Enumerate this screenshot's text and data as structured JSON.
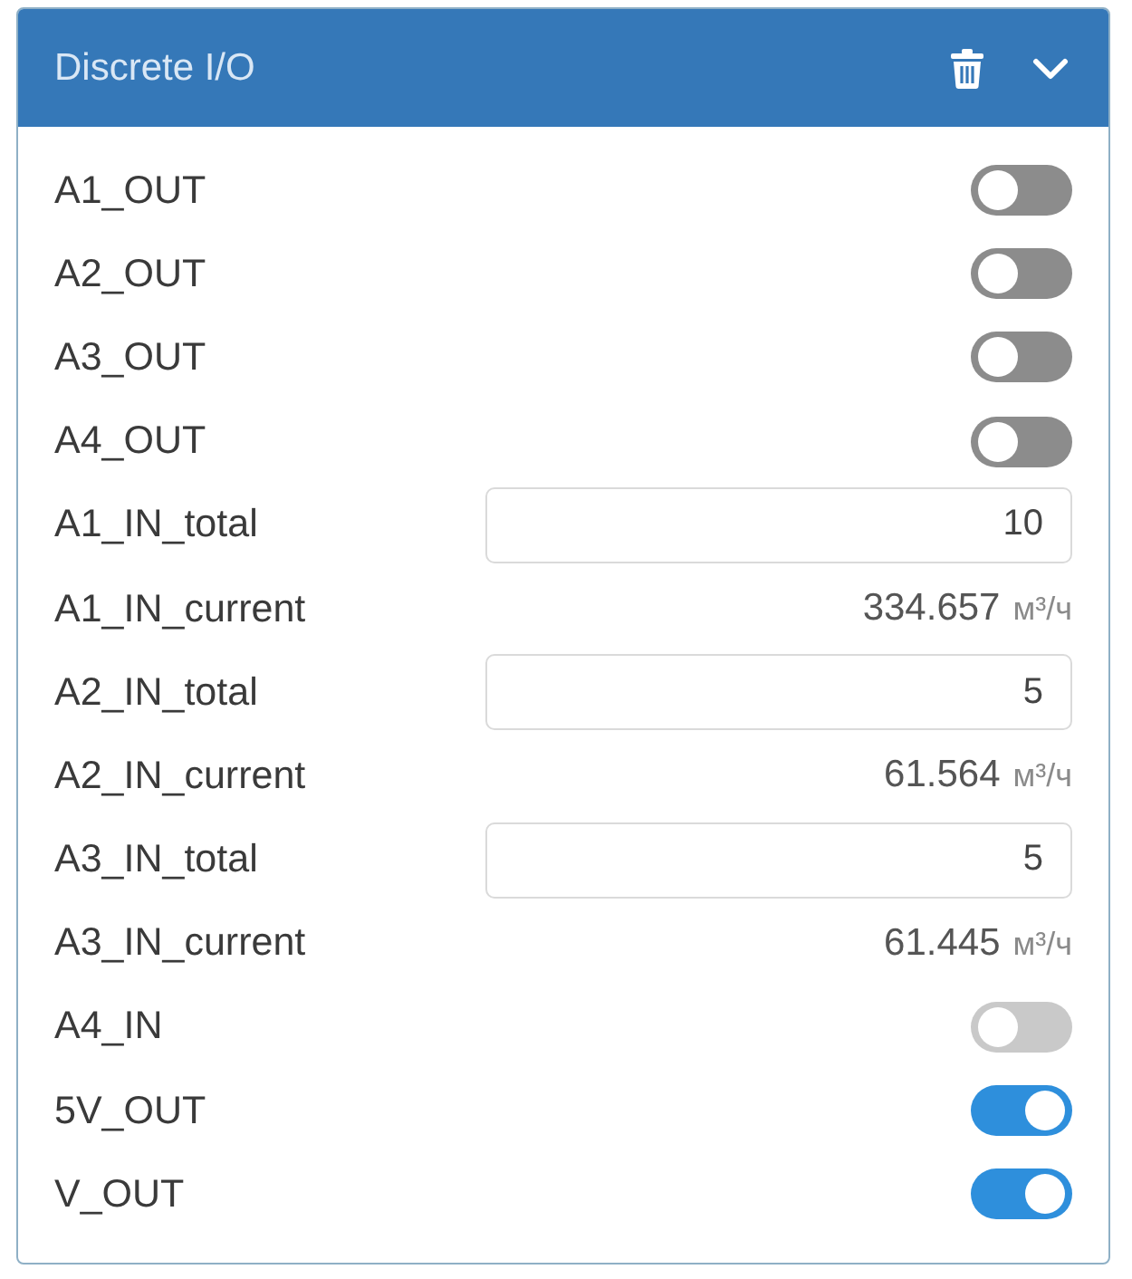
{
  "panel": {
    "title": "Discrete I/O",
    "expanded": true
  },
  "rows": [
    {
      "kind": "toggle",
      "label": "A1_OUT",
      "on": false,
      "disabled": false
    },
    {
      "kind": "toggle",
      "label": "A2_OUT",
      "on": false,
      "disabled": false
    },
    {
      "kind": "toggle",
      "label": "A3_OUT",
      "on": false,
      "disabled": false
    },
    {
      "kind": "toggle",
      "label": "A4_OUT",
      "on": false,
      "disabled": false
    },
    {
      "kind": "input",
      "label": "A1_IN_total",
      "value": "10"
    },
    {
      "kind": "reading",
      "label": "A1_IN_current",
      "value": "334.657",
      "unit": "м³/ч"
    },
    {
      "kind": "input",
      "label": "A2_IN_total",
      "value": "5"
    },
    {
      "kind": "reading",
      "label": "A2_IN_current",
      "value": "61.564",
      "unit": "м³/ч"
    },
    {
      "kind": "input",
      "label": "A3_IN_total",
      "value": "5"
    },
    {
      "kind": "reading",
      "label": "A3_IN_current",
      "value": "61.445",
      "unit": "м³/ч"
    },
    {
      "kind": "toggle",
      "label": "A4_IN",
      "on": false,
      "disabled": true
    },
    {
      "kind": "toggle",
      "label": "5V_OUT",
      "on": true,
      "disabled": false
    },
    {
      "kind": "toggle",
      "label": "V_OUT",
      "on": true,
      "disabled": false
    }
  ]
}
